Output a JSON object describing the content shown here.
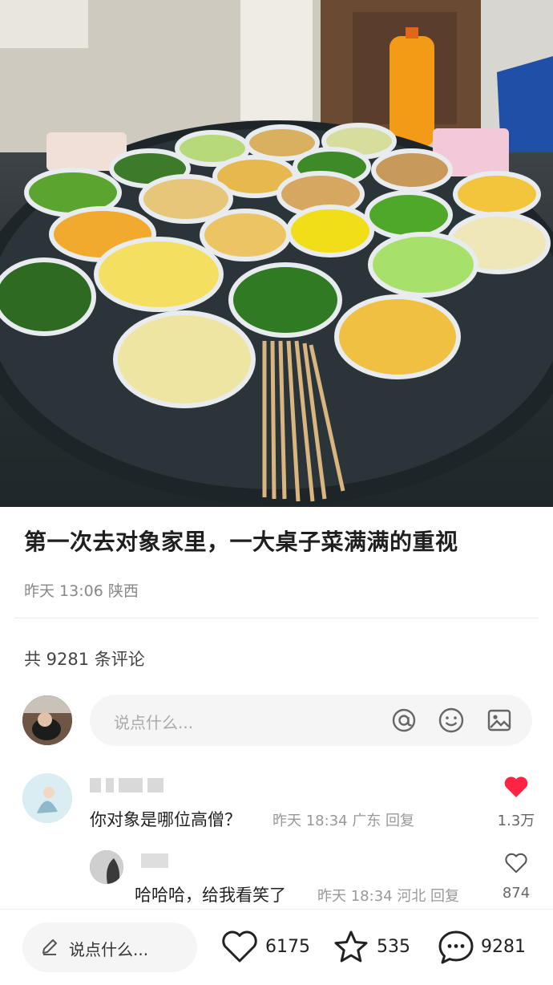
{
  "post": {
    "title": "第一次去对象家里，一大桌子菜满满的重视",
    "meta": "昨天 13:06 陕西"
  },
  "comments_header": {
    "count_text": "共 9281 条评论"
  },
  "comment_input": {
    "placeholder": "说点什么..."
  },
  "comments": [
    {
      "text": "你对象是哪位高僧？",
      "meta": "昨天 18:34 广东 回复",
      "likes": "1.3万",
      "liked": true,
      "replies": [
        {
          "text": "哈哈哈，给我看笑了",
          "meta": "昨天 18:34 河北 回复",
          "likes": "874",
          "liked": false
        }
      ]
    }
  ],
  "bottom_bar": {
    "input_placeholder": "说点什么...",
    "likes": "6175",
    "favorites": "535",
    "comments": "9281"
  },
  "colors": {
    "like_red": "#ff2442",
    "divider": "#ececec",
    "meta_gray": "#999999"
  },
  "icons": [
    "at-icon",
    "emoji-icon",
    "image-icon",
    "heart-icon",
    "star-icon",
    "comment-bubble-icon",
    "pencil-icon"
  ]
}
